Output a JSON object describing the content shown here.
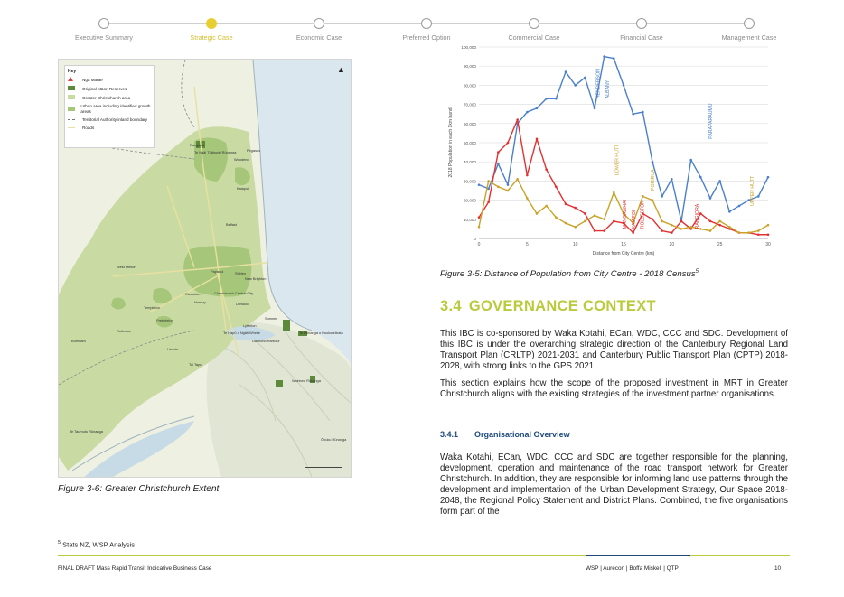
{
  "nav": {
    "steps": [
      {
        "label": "Executive Summary",
        "active": false
      },
      {
        "label": "Strategic Case",
        "active": true
      },
      {
        "label": "Economic Case",
        "active": false
      },
      {
        "label": "Preferred Option",
        "active": false
      },
      {
        "label": "Commercial Case",
        "active": false
      },
      {
        "label": "Financial Case",
        "active": false
      },
      {
        "label": "Management Case",
        "active": false
      }
    ],
    "active_color": "#e7cf32"
  },
  "map": {
    "key_title": "Key",
    "legend": [
      {
        "label": "Ngā Marae",
        "swatch": "triangle-red"
      },
      {
        "label": "Original Māori Reserves",
        "swatch": "dark-green"
      },
      {
        "label": "Greater Christchurch area",
        "swatch": "light-green"
      },
      {
        "label": "Urban area including identified growth areas",
        "swatch": "mid-green"
      },
      {
        "label": "Territorial Authority inland boundary",
        "swatch": "dashed"
      },
      {
        "label": "Roads",
        "swatch": "line"
      }
    ],
    "places": [
      {
        "name": "Rangiora"
      },
      {
        "name": "Te Ngāi Tūāhuriri Rūnanga"
      },
      {
        "name": "Pegasus"
      },
      {
        "name": "Woodend"
      },
      {
        "name": "Kaiapoi"
      },
      {
        "name": "Belfast"
      },
      {
        "name": "Papanui"
      },
      {
        "name": "Shirley"
      },
      {
        "name": "New Brighton"
      },
      {
        "name": "West Melton"
      },
      {
        "name": "Riccarton"
      },
      {
        "name": "Christchurch Central City"
      },
      {
        "name": "Hornby"
      },
      {
        "name": "Linwood"
      },
      {
        "name": "Templeton"
      },
      {
        "name": "Sumner"
      },
      {
        "name": "Rolleston"
      },
      {
        "name": "Prebbleton"
      },
      {
        "name": "Te Hapū o Ngāti Wheke"
      },
      {
        "name": "Lyttelton"
      },
      {
        "name": "Diamond Harbour"
      },
      {
        "name": "Te Rūnanga o Koukourārata"
      },
      {
        "name": "Burnham"
      },
      {
        "name": "Lincoln"
      },
      {
        "name": "Tai Tapu"
      },
      {
        "name": "Wairewa Rūnanga"
      },
      {
        "name": "Te Taumutu Rūnanga"
      },
      {
        "name": "Ōnuku Rūnanga"
      }
    ]
  },
  "map_caption": "Figure 3-6: Greater Christchurch Extent",
  "chart_caption": "Figure 3-5: Distance of Population from City Centre - 2018 Census",
  "chart_caption_sup": "5",
  "chart_data": {
    "type": "line",
    "xlabel": "Distance from City Centre (km)",
    "ylabel": "2018 Population in each 1km band",
    "xlim": [
      0,
      30
    ],
    "ylim": [
      0,
      100000
    ],
    "xticks": [
      0,
      5,
      10,
      15,
      20,
      25,
      30
    ],
    "yticks": [
      0,
      10000,
      20000,
      30000,
      40000,
      50000,
      60000,
      70000,
      80000,
      90000,
      100000
    ],
    "ytick_labels": [
      "0",
      "10,000",
      "20,000",
      "30,000",
      "40,000",
      "50,000",
      "60,000",
      "70,000",
      "80,000",
      "90,000",
      "100,000"
    ],
    "grid": true,
    "series": [
      {
        "color": "#4a7fcb",
        "x": [
          0,
          1,
          2,
          3,
          4,
          5,
          6,
          7,
          8,
          9,
          10,
          11,
          12,
          13,
          14,
          15,
          16,
          17,
          18,
          19,
          20,
          21,
          22,
          23,
          24,
          25,
          26,
          27,
          28,
          29,
          30
        ],
        "y": [
          28000,
          26000,
          39000,
          28000,
          60000,
          66000,
          68000,
          73000,
          73000,
          87000,
          80000,
          84000,
          68000,
          95000,
          94000,
          80000,
          65000,
          66000,
          40000,
          22000,
          31000,
          9000,
          41000,
          32000,
          21000,
          30000,
          14000,
          17000,
          20000,
          22000,
          32000
        ]
      },
      {
        "color": "#e33030",
        "x": [
          0,
          1,
          2,
          3,
          4,
          5,
          6,
          7,
          8,
          9,
          10,
          11,
          12,
          13,
          14,
          15,
          16,
          17,
          18,
          19,
          20,
          21,
          22,
          23,
          24,
          25,
          26,
          27,
          28,
          29,
          30
        ],
        "y": [
          11000,
          19000,
          45000,
          50000,
          62000,
          33000,
          52000,
          36000,
          27000,
          18000,
          16000,
          13000,
          4000,
          4000,
          9000,
          8000,
          3000,
          13000,
          10000,
          4000,
          3000,
          9000,
          5000,
          13000,
          9000,
          7000,
          5000,
          3000,
          3000,
          2000,
          2000
        ]
      },
      {
        "color": "#c9a227",
        "x": [
          0,
          1,
          2,
          3,
          4,
          5,
          6,
          7,
          8,
          9,
          10,
          11,
          12,
          13,
          14,
          15,
          16,
          17,
          18,
          19,
          20,
          21,
          22,
          23,
          24,
          25,
          26,
          27,
          28,
          29,
          30
        ],
        "y": [
          6000,
          30000,
          27000,
          25000,
          31000,
          21000,
          13000,
          17000,
          11000,
          8000,
          6000,
          9000,
          12000,
          10000,
          24000,
          13000,
          8000,
          22000,
          20000,
          9000,
          7000,
          5000,
          6000,
          5000,
          4000,
          9000,
          6000,
          3000,
          3000,
          4000,
          7000
        ]
      }
    ],
    "annotations": [
      {
        "text": "HENDERSON",
        "color": "#4a7fcb",
        "x": 12.5,
        "y": 73000
      },
      {
        "text": "ALBANY",
        "color": "#4a7fcb",
        "x": 13.5,
        "y": 73000
      },
      {
        "text": "LOWER HUTT",
        "color": "#c9a227",
        "x": 14.5,
        "y": 33000
      },
      {
        "text": "PORIRUA",
        "color": "#c9a227",
        "x": 18.2,
        "y": 25000
      },
      {
        "text": "PARAPARAUMU",
        "color": "#4a7fcb",
        "x": 24.2,
        "y": 52000
      },
      {
        "text": "UPPER HUTT",
        "color": "#c9a227",
        "x": 28.5,
        "y": 17000
      },
      {
        "text": "MANGAWHAI",
        "color": "#e33030",
        "x": 15.3,
        "y": 5000
      },
      {
        "text": "KAIAPOI",
        "color": "#e33030",
        "x": 16.2,
        "y": 5000
      },
      {
        "text": "ROLLESTON",
        "color": "#e33030",
        "x": 17.1,
        "y": 5000
      },
      {
        "text": "RANGIORA",
        "color": "#e33030",
        "x": 22.8,
        "y": 5000
      }
    ]
  },
  "section": {
    "number": "3.4",
    "title": "GOVERNANCE CONTEXT",
    "para1": "This IBC is co-sponsored by Waka Kotahi, ECan, WDC, CCC and SDC. Development of this IBC is under the overarching strategic direction of the Canterbury Regional Land Transport Plan (CRLTP) 2021-2031 and Canterbury Public Transport Plan (CPTP) 2018-2028, with strong links to the GPS 2021.",
    "para2": "This section explains how the scope of the proposed investment in MRT in Greater Christchurch aligns with the existing strategies of the investment partner organisations.",
    "sub_number": "3.4.1",
    "sub_title": "Organisational Overview",
    "para3": "Waka Kotahi, ECan, WDC, CCC and SDC are together responsible for the planning, development, operation and maintenance of the road transport network for Greater Christchurch. In addition, they are responsible for informing land use patterns through the development and implementation of the Urban Development Strategy, Our Space 2018-2048, the Regional Policy Statement and District Plans. Combined, the five organisations form part of the"
  },
  "footnote": {
    "mark": "5",
    "text": "Stats NZ, WSP Analysis"
  },
  "footer": {
    "left": "FINAL DRAFT Mass Rapid Transit Indicative Business Case",
    "right": "WSP | Aurecon | Boffa Miskell | QTP",
    "page": "10"
  },
  "colors": {
    "accent_green": "#b9ca3b",
    "accent_blue": "#1f4a7e"
  }
}
